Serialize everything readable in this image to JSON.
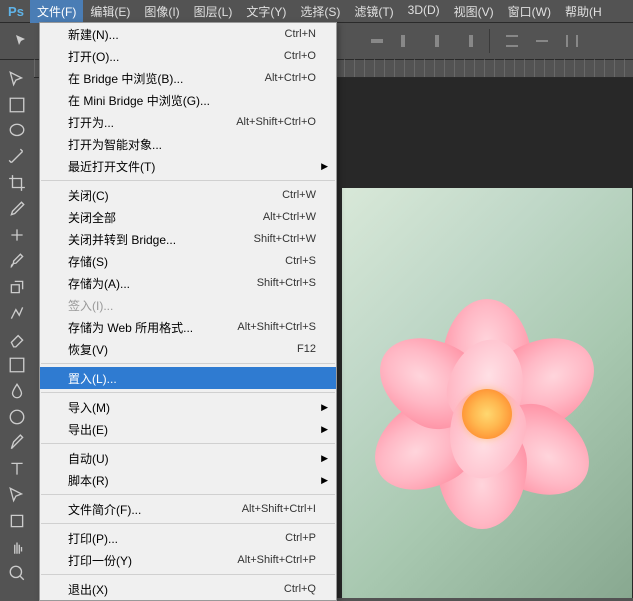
{
  "logo": "Ps",
  "menubar": {
    "items": [
      {
        "label": "文件(F)",
        "active": true
      },
      {
        "label": "编辑(E)"
      },
      {
        "label": "图像(I)"
      },
      {
        "label": "图层(L)"
      },
      {
        "label": "文字(Y)"
      },
      {
        "label": "选择(S)"
      },
      {
        "label": "滤镜(T)"
      },
      {
        "label": "3D(D)"
      },
      {
        "label": "视图(V)"
      },
      {
        "label": "窗口(W)"
      },
      {
        "label": "帮助(H"
      }
    ]
  },
  "dropdown": {
    "groups": [
      [
        {
          "label": "新建(N)...",
          "shortcut": "Ctrl+N"
        },
        {
          "label": "打开(O)...",
          "shortcut": "Ctrl+O"
        },
        {
          "label": "在 Bridge 中浏览(B)...",
          "shortcut": "Alt+Ctrl+O"
        },
        {
          "label": "在 Mini Bridge 中浏览(G)..."
        },
        {
          "label": "打开为...",
          "shortcut": "Alt+Shift+Ctrl+O"
        },
        {
          "label": "打开为智能对象..."
        },
        {
          "label": "最近打开文件(T)",
          "submenu": true
        }
      ],
      [
        {
          "label": "关闭(C)",
          "shortcut": "Ctrl+W"
        },
        {
          "label": "关闭全部",
          "shortcut": "Alt+Ctrl+W"
        },
        {
          "label": "关闭并转到 Bridge...",
          "shortcut": "Shift+Ctrl+W"
        },
        {
          "label": "存储(S)",
          "shortcut": "Ctrl+S"
        },
        {
          "label": "存储为(A)...",
          "shortcut": "Shift+Ctrl+S"
        },
        {
          "label": "签入(I)...",
          "disabled": true
        },
        {
          "label": "存储为 Web 所用格式...",
          "shortcut": "Alt+Shift+Ctrl+S"
        },
        {
          "label": "恢复(V)",
          "shortcut": "F12"
        }
      ],
      [
        {
          "label": "置入(L)...",
          "highlighted": true
        }
      ],
      [
        {
          "label": "导入(M)",
          "submenu": true
        },
        {
          "label": "导出(E)",
          "submenu": true
        }
      ],
      [
        {
          "label": "自动(U)",
          "submenu": true
        },
        {
          "label": "脚本(R)",
          "submenu": true
        }
      ],
      [
        {
          "label": "文件简介(F)...",
          "shortcut": "Alt+Shift+Ctrl+I"
        }
      ],
      [
        {
          "label": "打印(P)...",
          "shortcut": "Ctrl+P"
        },
        {
          "label": "打印一份(Y)",
          "shortcut": "Alt+Shift+Ctrl+P"
        }
      ],
      [
        {
          "label": "退出(X)",
          "shortcut": "Ctrl+Q"
        }
      ]
    ]
  },
  "tools": [
    "move",
    "marquee",
    "lasso",
    "magic-wand",
    "crop",
    "eyedropper",
    "healing",
    "brush",
    "clone",
    "history",
    "eraser",
    "gradient",
    "blur",
    "dodge",
    "pen",
    "type",
    "path",
    "rectangle",
    "hand",
    "zoom"
  ]
}
